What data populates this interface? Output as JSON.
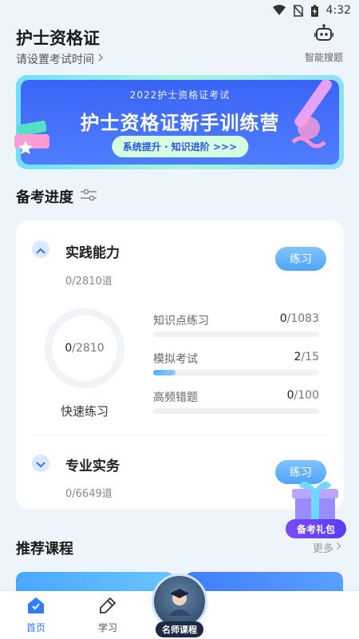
{
  "status_bar": {
    "time": "4:32"
  },
  "header": {
    "title": "护士资格证",
    "exam_time_label": "请设置考试时间",
    "ai_search_label": "智能搜题"
  },
  "banner": {
    "subtitle": "2022护士资格证考试",
    "title": "护士资格证新手训练营",
    "pill": "系统提升 · 知识进阶 >>>"
  },
  "progress_section": {
    "title": "备考进度",
    "categories": [
      {
        "name": "实践能力",
        "count_done": "0",
        "count_total": "/2810道",
        "button": "练习",
        "ring_done": "0",
        "ring_total": "/2810",
        "quick_label": "快速练习",
        "stats": [
          {
            "label": "知识点练习",
            "done": "0",
            "total": "/1083",
            "fraction": 0.0
          },
          {
            "label": "模拟考试",
            "done": "2",
            "total": "/15",
            "fraction": 0.133
          },
          {
            "label": "高频错题",
            "done": "0",
            "total": "/100",
            "fraction": 0.0
          }
        ]
      },
      {
        "name": "专业实务",
        "count_done": "0",
        "count_total": "/6649道",
        "button": "练习"
      }
    ]
  },
  "gift": {
    "label": "备考礼包"
  },
  "courses": {
    "title": "推荐课程",
    "more": "更多"
  },
  "tabbar": {
    "home": "首页",
    "study": "学习",
    "teacher": "名师课程"
  },
  "colors": {
    "accent": "#2f7cff",
    "button": "#4fa4ff",
    "banner": "#3a64f5"
  }
}
